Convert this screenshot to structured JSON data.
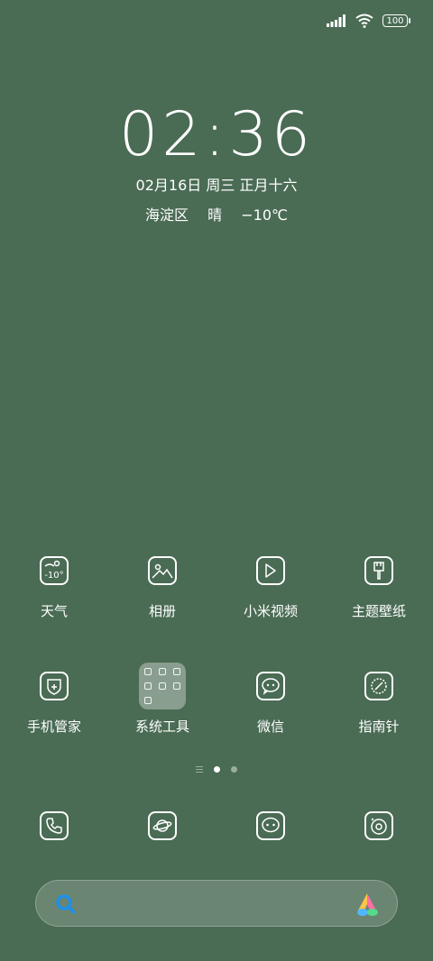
{
  "status": {
    "battery": "100",
    "signal_icon": "signal-bars-icon",
    "wifi_icon": "wifi-icon"
  },
  "lockscreen": {
    "time": "02:36",
    "date": "02月16日 周三 正月十六",
    "location": "海淀区",
    "weather": "晴",
    "temperature": "−10℃"
  },
  "apps_row1": [
    {
      "label": "天气",
      "icon": "weather-icon",
      "icon_text": "-10°"
    },
    {
      "label": "相册",
      "icon": "gallery-icon"
    },
    {
      "label": "小米视频",
      "icon": "video-play-icon"
    },
    {
      "label": "主题壁纸",
      "icon": "theme-brush-icon"
    }
  ],
  "apps_row2": [
    {
      "label": "手机管家",
      "icon": "security-shield-icon"
    },
    {
      "label": "系统工具",
      "icon": "folder-icon"
    },
    {
      "label": "微信",
      "icon": "wechat-chat-icon"
    },
    {
      "label": "指南针",
      "icon": "compass-icon"
    }
  ],
  "dock": [
    {
      "icon": "phone-icon"
    },
    {
      "icon": "browser-planet-icon"
    },
    {
      "icon": "messages-icon"
    },
    {
      "icon": "camera-icon"
    }
  ],
  "search": {
    "icon": "search-icon",
    "assistant_icon": "assistant-logo-icon"
  },
  "colors": {
    "wallpaper": "#4a6b54",
    "search_icon": "#1e90e8"
  }
}
